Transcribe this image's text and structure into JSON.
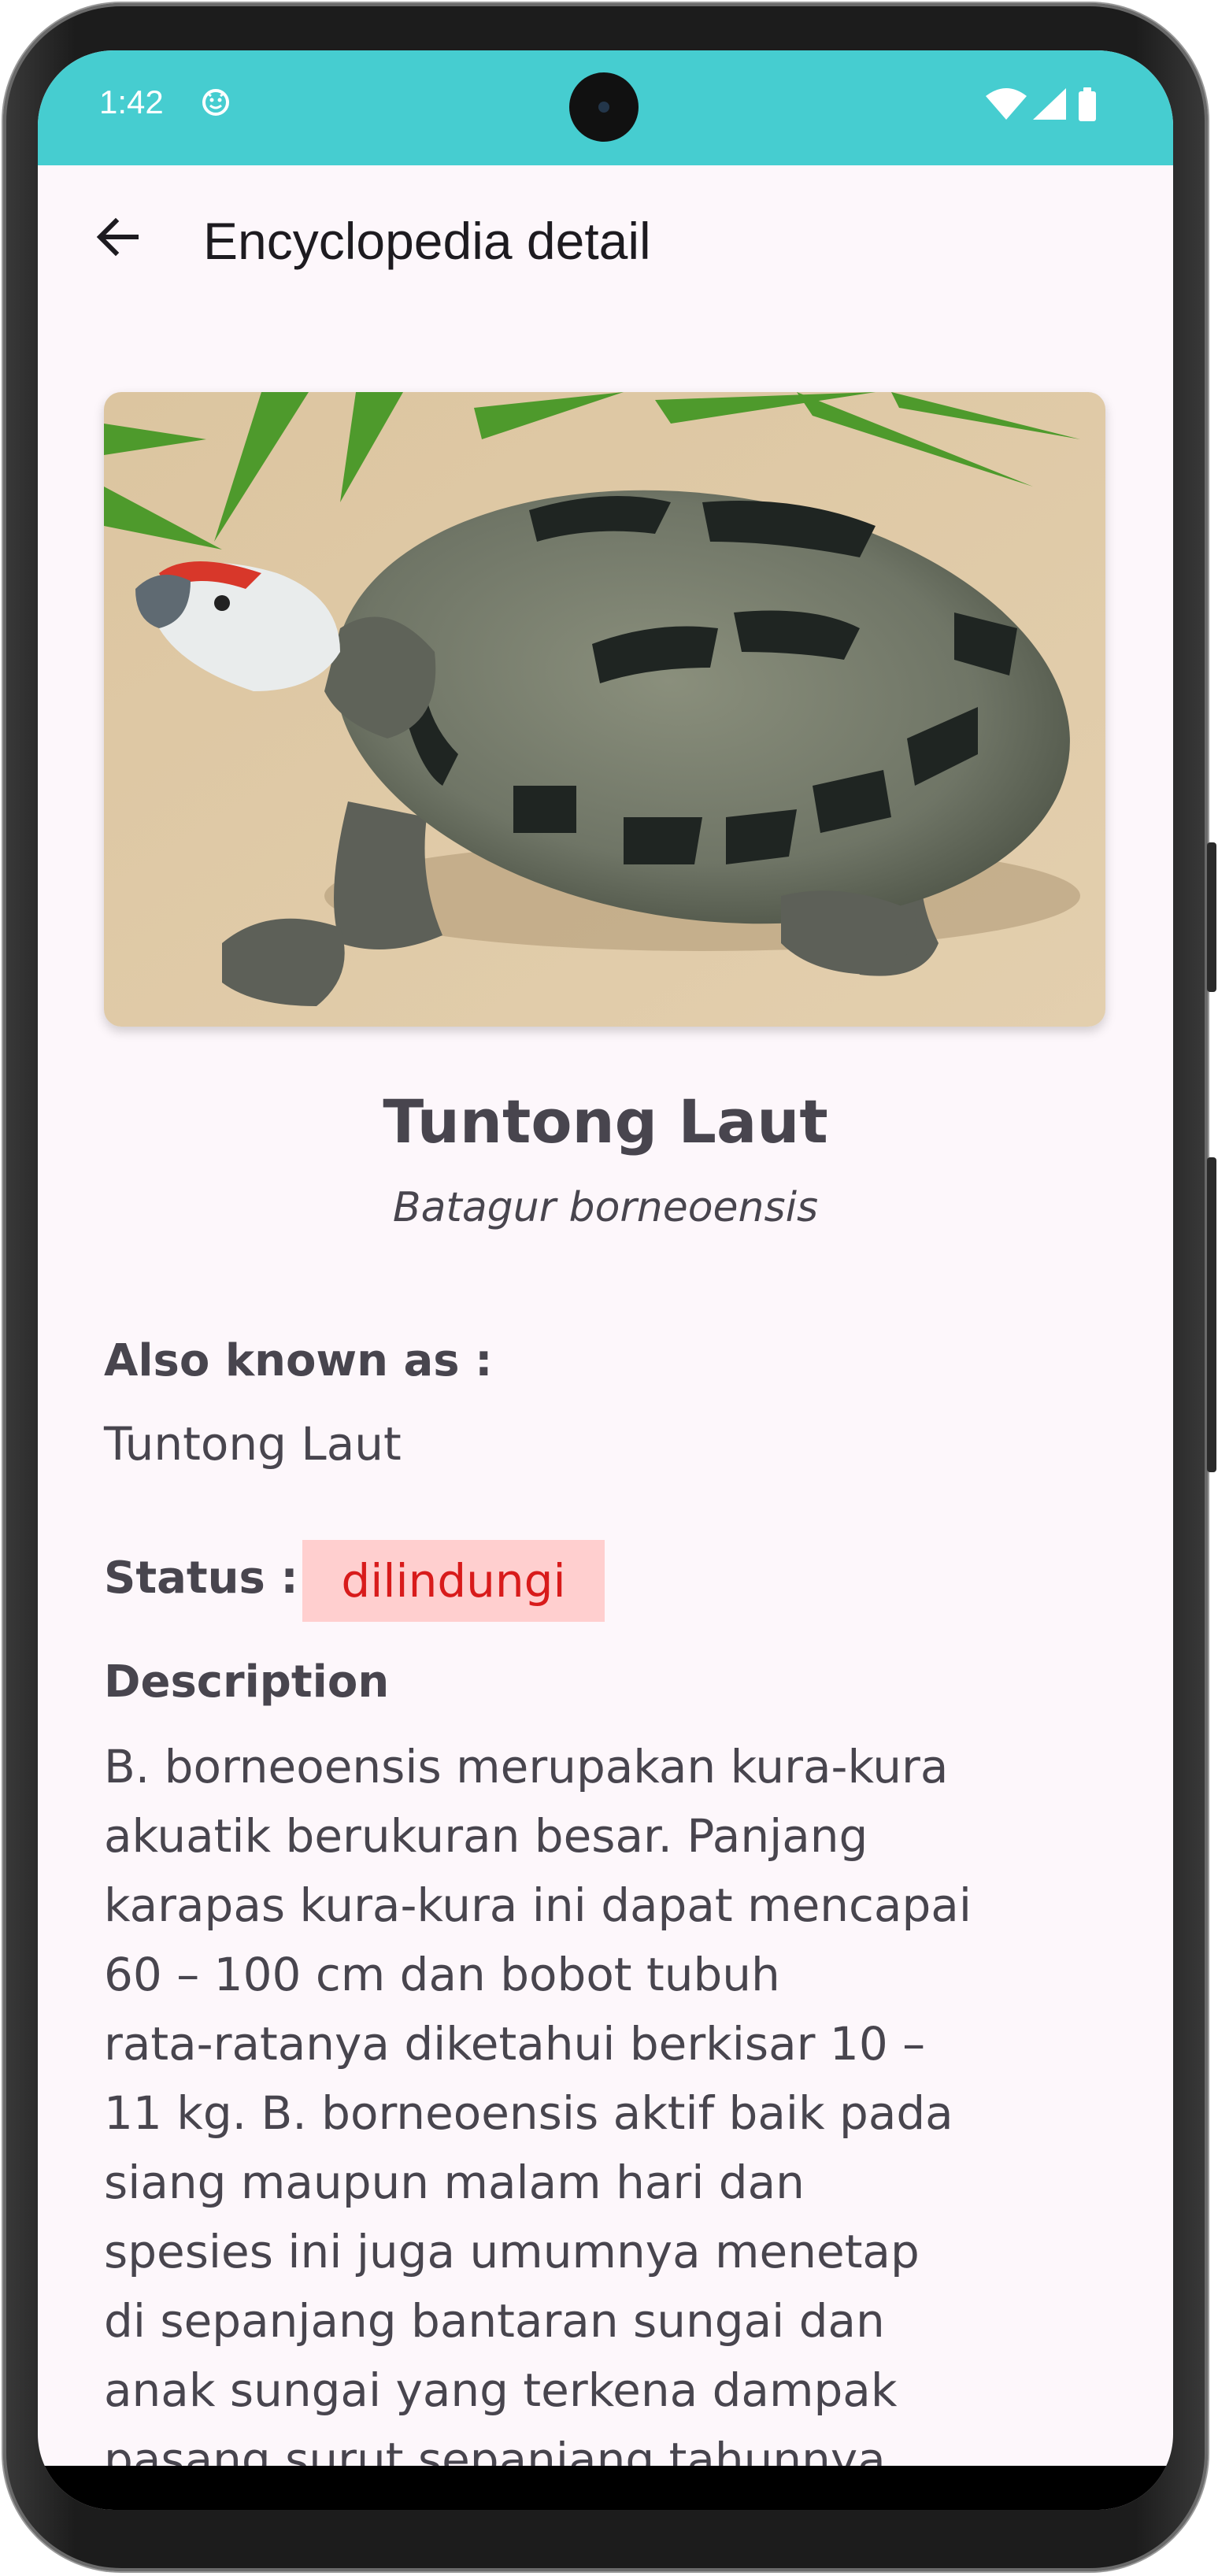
{
  "status_bar": {
    "time": "1:42",
    "icons": [
      "smiley-icon",
      "wifi-icon",
      "signal-icon",
      "battery-icon"
    ]
  },
  "app_bar": {
    "back_icon": "arrow-left-icon",
    "title": "Encyclopedia detail"
  },
  "species": {
    "name": "Tuntong Laut",
    "scientific_name": "Batagur borneoensis",
    "also_known_as_label": "Also known as :",
    "also_known_as": "Tuntong Laut",
    "status_label": "Status :",
    "status": "dilindungi",
    "description_label": "Description",
    "description_lines": [
      "B. borneoensis merupakan kura-kura",
      "akuatik berukuran besar. Panjang",
      "karapas kura-kura ini dapat mencapai",
      "60 – 100 cm dan bobot tubuh",
      "rata-ratanya diketahui berkisar 10 –",
      "11 kg. B. borneoensis aktif baik pada",
      "siang maupun malam hari dan",
      "spesies ini juga umumnya menetap",
      "di sepanjang bantaran sungai dan",
      "anak sungai yang terkena dampak",
      "pasang surut sepanjang tahunnya."
    ]
  },
  "colors": {
    "status_bar": "#46cdd0",
    "background": "#fdf7fb",
    "text": "#48454e",
    "badge_bg": "#ffcfcf",
    "badge_text": "#d81b1b"
  }
}
